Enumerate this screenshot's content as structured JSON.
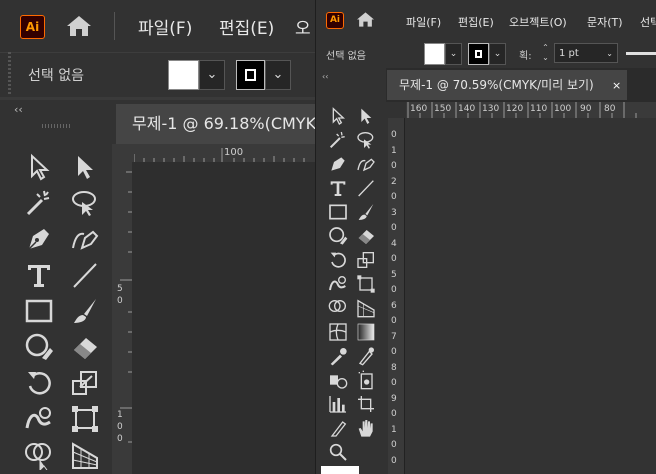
{
  "back_window": {
    "logo": "Ai",
    "menus": [
      "파일(F)",
      "편집(E)",
      "오"
    ],
    "control_bar": {
      "selection_label": "선택 없음"
    },
    "document_tab": "무제-1 @ 69.18%(CMYK",
    "ruler_marks": {
      "h_label": "100",
      "v_labels": [
        "5",
        "0",
        "1",
        "0",
        "0"
      ]
    }
  },
  "front_window": {
    "logo": "Ai",
    "menus": [
      "파일(F)",
      "편집(E)",
      "오브젝트(O)",
      "문자(T)",
      "선택"
    ],
    "control_bar": {
      "selection_label": "선택 없음",
      "stroke_label": "획:",
      "stroke_weight": "1 pt"
    },
    "document_tab": "무제-1 @ 70.59%(CMYK/미리 보기)",
    "close_glyph": "×",
    "h_ruler_labels": [
      "160",
      "150",
      "140",
      "130",
      "120",
      "110",
      "100",
      "90",
      "80"
    ],
    "v_ruler_labels": [
      "0",
      "1",
      "0",
      "2",
      "0",
      "3",
      "0",
      "4",
      "0",
      "5",
      "0",
      "6",
      "0",
      "7",
      "0",
      "8",
      "0",
      "9",
      "0",
      "1",
      "0",
      "0"
    ]
  },
  "tools": [
    "selection",
    "direct-selection",
    "magic-wand",
    "lasso",
    "pen",
    "curvature",
    "type",
    "line",
    "rectangle",
    "paintbrush",
    "shaper",
    "eraser",
    "rotate",
    "scale",
    "warp",
    "free-transform",
    "shape-builder",
    "perspective-grid",
    "mesh",
    "gradient",
    "eyedropper",
    "blend",
    "symbol-sprayer",
    "column-graph",
    "artboard",
    "slice",
    "zoom",
    "hand"
  ]
}
